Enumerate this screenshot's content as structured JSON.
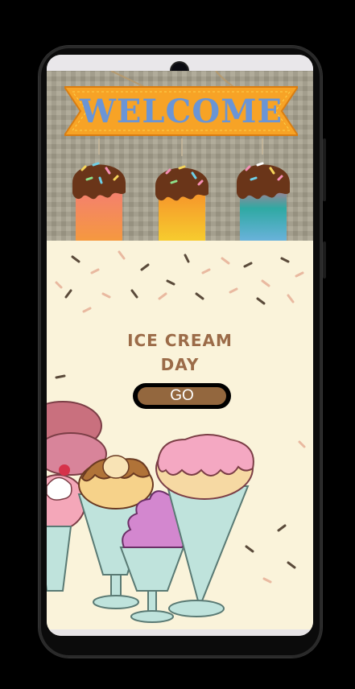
{
  "banner": {
    "sign_text": "WELCOME",
    "colors": {
      "sign": "#f7a326",
      "letters": "#6a95d6",
      "chocolate": "#6a3519"
    }
  },
  "main": {
    "title_line1": "ICE CREAM",
    "title_line2": "DAY",
    "go_label": "GO",
    "colors": {
      "background": "#faf3da",
      "title": "#9b6b48",
      "button": "#93673e"
    }
  }
}
